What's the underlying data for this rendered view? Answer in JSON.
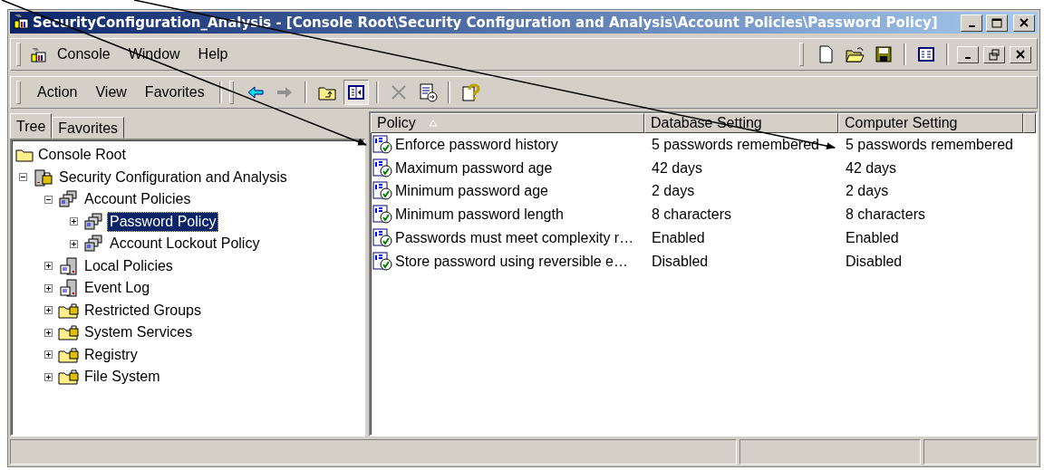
{
  "window": {
    "title": "SecurityConfiguration_Analysis - [Console Root\\Security Configuration and Analysis\\Account Policies\\Password Policy]"
  },
  "menu_bar": {
    "items": [
      "Console",
      "Window",
      "Help"
    ]
  },
  "action_bar": {
    "items": [
      "Action",
      "View",
      "Favorites"
    ]
  },
  "tabs": [
    {
      "label": "Tree",
      "selected": true
    },
    {
      "label": "Favorites",
      "selected": false
    }
  ],
  "tree": [
    {
      "label": "Console Root",
      "kind": "folder",
      "selected": false,
      "children": [
        {
          "label": "Security Configuration and Analysis",
          "kind": "lockserver",
          "expanded": true,
          "selected": false,
          "children": [
            {
              "label": "Account Policies",
              "kind": "computers",
              "expanded": true,
              "selected": false,
              "children": [
                {
                  "label": "Password Policy",
                  "kind": "computers",
                  "expanded": false,
                  "selected": true
                },
                {
                  "label": "Account Lockout Policy",
                  "kind": "computers",
                  "expanded": false,
                  "selected": false
                }
              ]
            },
            {
              "label": "Local Policies",
              "kind": "server",
              "expanded": false,
              "selected": false
            },
            {
              "label": "Event Log",
              "kind": "server",
              "expanded": false,
              "selected": false
            },
            {
              "label": "Restricted Groups",
              "kind": "lockfolder",
              "expanded": false,
              "selected": false
            },
            {
              "label": "System Services",
              "kind": "lockfolder",
              "expanded": false,
              "selected": false
            },
            {
              "label": "Registry",
              "kind": "lockfolder",
              "expanded": false,
              "selected": false
            },
            {
              "label": "File System",
              "kind": "lockfolder",
              "expanded": false,
              "selected": false
            }
          ]
        }
      ]
    }
  ],
  "table": {
    "columns": [
      {
        "label": "Policy",
        "sorted": true
      },
      {
        "label": "Database Setting",
        "sorted": false
      },
      {
        "label": "Computer Setting",
        "sorted": false
      }
    ],
    "rows": [
      [
        "Enforce password history",
        "5 passwords remembered",
        "5 passwords remembered"
      ],
      [
        "Maximum password age",
        "42 days",
        "42 days"
      ],
      [
        "Minimum password age",
        "2 days",
        "2 days"
      ],
      [
        "Minimum password length",
        "8 characters",
        "8 characters"
      ],
      [
        "Passwords must meet complexity r…",
        "Enabled",
        "Enabled"
      ],
      [
        "Store password using reversible e…",
        "Disabled",
        "Disabled"
      ]
    ]
  }
}
